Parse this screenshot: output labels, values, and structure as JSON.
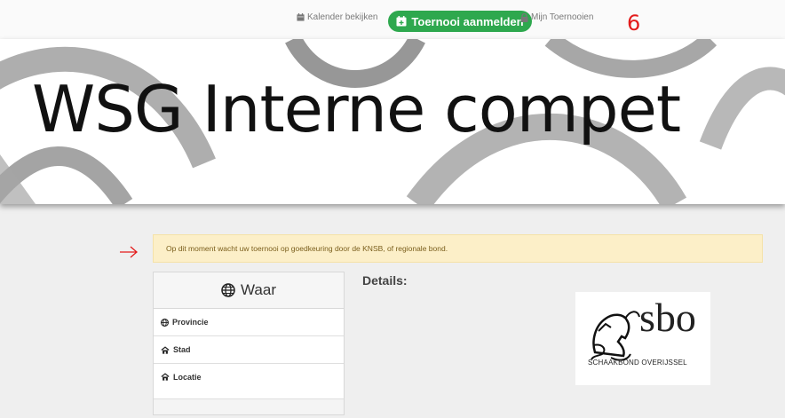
{
  "nav": {
    "calendar_label": "Kalender bekijken",
    "register_label": "Toernooi aanmelden",
    "my_tournaments_label": "Mijn Toernooien",
    "accent": "#2ea84e"
  },
  "annotations": {
    "number": "6",
    "arrow": "→",
    "color": "#e31b1b"
  },
  "banner": {
    "title": "WSG Interne compet"
  },
  "alert": {
    "text": "Op dit moment wacht uw toernooi op goedkeuring door de KNSB, of regionale bond."
  },
  "where_card": {
    "title": "Waar",
    "rows": [
      {
        "icon": "globe-icon",
        "label": "Provincie"
      },
      {
        "icon": "home-icon",
        "label": "Stad"
      },
      {
        "icon": "home-icon",
        "label": "Locatie"
      }
    ]
  },
  "details": {
    "heading": "Details:"
  },
  "logo": {
    "wordmark": "sbo",
    "subtitle": "SCHAAKBOND OVERIJSSEL"
  }
}
